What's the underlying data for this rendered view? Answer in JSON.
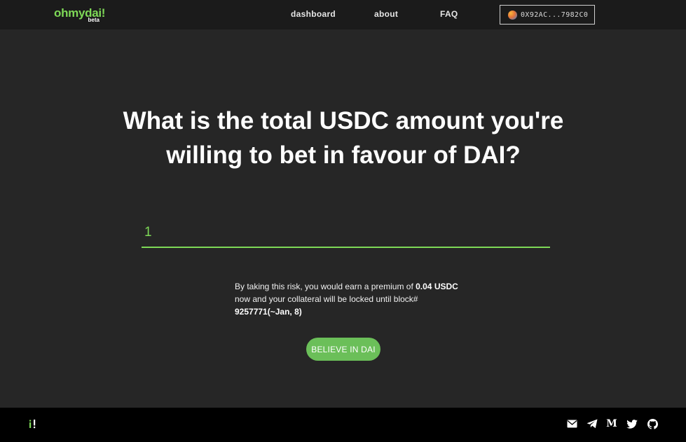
{
  "header": {
    "logo_text": "ohmydai!",
    "logo_badge": "beta",
    "nav": {
      "dashboard": "dashboard",
      "about": "about",
      "faq": "FAQ"
    },
    "wallet_address": "0X92AC...7982C0"
  },
  "main": {
    "question_line1": "What is the total USDC amount you're",
    "question_line2": "willing to bet in favour of DAI?",
    "amount_value": "1",
    "premium": {
      "prefix": "By taking this risk, you would earn a premium of",
      "amount": "0.04 USDC",
      "middle": "now and your collateral will be locked until block#",
      "block": "9257771(~Jan, 8)"
    },
    "cta_label": "BELIEVE IN DAI"
  },
  "footer": {
    "icons": [
      "mail-icon",
      "telegram-icon",
      "medium-icon",
      "twitter-icon",
      "github-icon"
    ],
    "medium_glyph": "M"
  },
  "colors": {
    "accent": "#7ed957",
    "button": "#6bbf59",
    "background": "#262626",
    "header": "#1b1b1b",
    "footer": "#000000"
  }
}
